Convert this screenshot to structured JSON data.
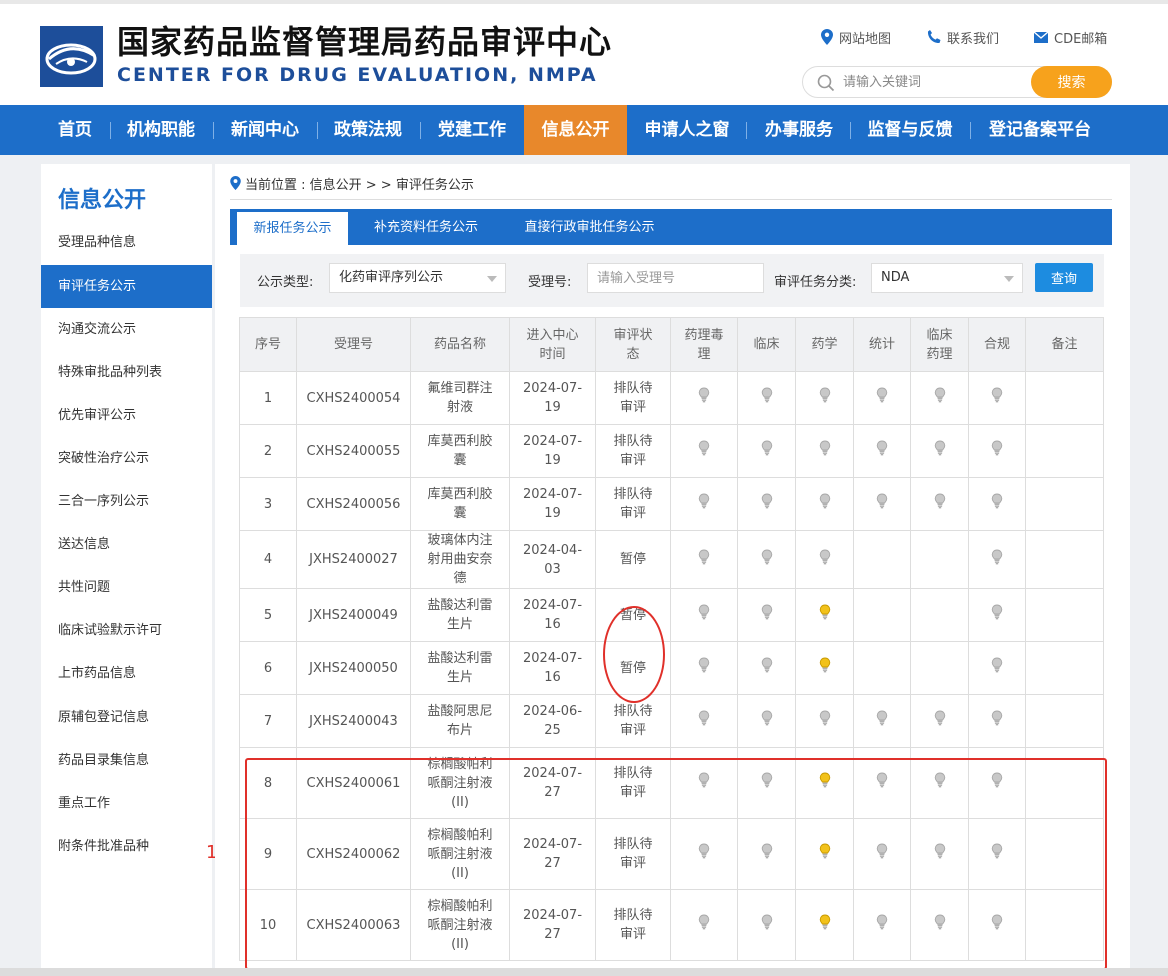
{
  "header": {
    "title": "国家药品监督管理局药品审评中心",
    "subtitle": "CENTER FOR DRUG EVALUATION, NMPA",
    "links": [
      {
        "icon": "map-pin-icon",
        "label": "网站地图"
      },
      {
        "icon": "phone-icon",
        "label": "联系我们"
      },
      {
        "icon": "mail-icon",
        "label": "CDE邮箱"
      }
    ],
    "search": {
      "placeholder": "请输入关键词",
      "button": "搜索"
    }
  },
  "nav": {
    "items": [
      "首页",
      "机构职能",
      "新闻中心",
      "政策法规",
      "党建工作",
      "信息公开",
      "申请人之窗",
      "办事服务",
      "监督与反馈",
      "登记备案平台"
    ],
    "active": "信息公开"
  },
  "sidebar": {
    "title": "信息公开",
    "items": [
      "受理品种信息",
      "审评任务公示",
      "沟通交流公示",
      "特殊审批品种列表",
      "优先审评公示",
      "突破性治疗公示",
      "三合一序列公示",
      "送达信息",
      "共性问题",
      "临床试验默示许可",
      "上市药品信息",
      "原辅包登记信息",
      "药品目录集信息",
      "重点工作",
      "附条件批准品种"
    ],
    "active": "审评任务公示"
  },
  "breadcrumb": {
    "label": "当前位置 : 信息公开 > > 审评任务公示"
  },
  "tabs": [
    "新报任务公示",
    "补充资料任务公示",
    "直接行政审批任务公示"
  ],
  "filter": {
    "type_label": "公示类型:",
    "type_value": "化药审评序列公示",
    "acceptance_label": "受理号:",
    "acceptance_placeholder": "请输入受理号",
    "category_label": "审评任务分类:",
    "category_value": "NDA",
    "query_button": "查询"
  },
  "table": {
    "headers": [
      "序号",
      "受理号",
      "药品名称",
      "进入中心时间",
      "审评状态",
      "药理毒理",
      "临床",
      "药学",
      "统计",
      "临床药理",
      "合规",
      "备注"
    ],
    "rows": [
      {
        "no": "1",
        "id": "CXHS2400054",
        "name": "氟维司群注射液",
        "date": "2024-07-19",
        "status": "排队待审评",
        "marks": [
          "grey",
          "grey",
          "grey",
          "grey",
          "grey",
          "grey"
        ],
        "note": ""
      },
      {
        "no": "2",
        "id": "CXHS2400055",
        "name": "库莫西利胶囊",
        "date": "2024-07-19",
        "status": "排队待审评",
        "marks": [
          "grey",
          "grey",
          "grey",
          "grey",
          "grey",
          "grey"
        ],
        "note": ""
      },
      {
        "no": "3",
        "id": "CXHS2400056",
        "name": "库莫西利胶囊",
        "date": "2024-07-19",
        "status": "排队待审评",
        "marks": [
          "grey",
          "grey",
          "grey",
          "grey",
          "grey",
          "grey"
        ],
        "note": ""
      },
      {
        "no": "4",
        "id": "JXHS2400027",
        "name": "玻璃体内注射用曲安奈德",
        "date": "2024-04-03",
        "status": "暂停",
        "marks": [
          "grey",
          "grey",
          "grey",
          "",
          "",
          "grey"
        ],
        "note": ""
      },
      {
        "no": "5",
        "id": "JXHS2400049",
        "name": "盐酸达利雷生片",
        "date": "2024-07-16",
        "status": "暂停",
        "marks": [
          "grey",
          "grey",
          "yellow",
          "",
          "",
          "grey"
        ],
        "note": ""
      },
      {
        "no": "6",
        "id": "JXHS2400050",
        "name": "盐酸达利雷生片",
        "date": "2024-07-16",
        "status": "暂停",
        "marks": [
          "grey",
          "grey",
          "yellow",
          "",
          "",
          "grey"
        ],
        "note": ""
      },
      {
        "no": "7",
        "id": "JXHS2400043",
        "name": "盐酸阿思尼布片",
        "date": "2024-06-25",
        "status": "排队待审评",
        "marks": [
          "grey",
          "grey",
          "grey",
          "grey",
          "grey",
          "grey"
        ],
        "note": ""
      },
      {
        "no": "8",
        "id": "CXHS2400061",
        "name": "棕榈酸帕利哌酮注射液(II)",
        "date": "2024-07-27",
        "status": "排队待审评",
        "marks": [
          "grey",
          "grey",
          "yellow",
          "grey",
          "grey",
          "grey"
        ],
        "note": ""
      },
      {
        "no": "9",
        "id": "CXHS2400062",
        "name": "棕榈酸帕利哌酮注射液(II)",
        "date": "2024-07-27",
        "status": "排队待审评",
        "marks": [
          "grey",
          "grey",
          "yellow",
          "grey",
          "grey",
          "grey"
        ],
        "note": ""
      },
      {
        "no": "10",
        "id": "CXHS2400063",
        "name": "棕榈酸帕利哌酮注射液(II)",
        "date": "2024-07-27",
        "status": "排队待审评",
        "marks": [
          "grey",
          "grey",
          "yellow",
          "grey",
          "grey",
          "grey"
        ],
        "note": ""
      }
    ]
  },
  "annotation": {
    "label": "1"
  },
  "colors": {
    "brand_blue": "#1d6ec9",
    "active_orange": "#e8882b",
    "search_orange": "#f7a21c",
    "annotation_red": "#e0302a",
    "bulb_lit": "#f2c21b",
    "bulb_off": "#c8c8c8"
  }
}
